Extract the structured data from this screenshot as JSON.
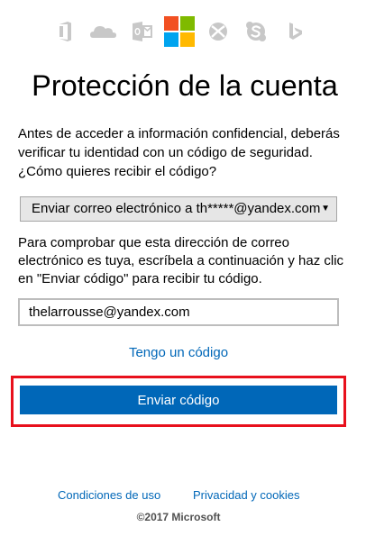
{
  "product_icons": [
    {
      "icon": "office-icon",
      "color": "#c8c8c8"
    },
    {
      "icon": "onedrive-icon",
      "color": "#c8c8c8"
    },
    {
      "icon": "outlook-icon",
      "color": "#c8c8c8"
    },
    {
      "icon": "microsoft-logo-icon",
      "colors": [
        "#f25022",
        "#7fba00",
        "#00a4ef",
        "#ffb900"
      ]
    },
    {
      "icon": "xbox-icon",
      "color": "#c8c8c8"
    },
    {
      "icon": "skype-icon",
      "color": "#c8c8c8"
    },
    {
      "icon": "bing-icon",
      "color": "#c8c8c8"
    }
  ],
  "title": "Protección de la cuenta",
  "intro_text": "Antes de acceder a información confidencial, deberás verificar tu identidad con un código de seguridad. ¿Cómo quieres recibir el código?",
  "method_select": {
    "selected_value": "Enviar correo electrónico a th*****@yandex.com",
    "arrow": "▼"
  },
  "verify_text": "Para comprobar que esta dirección de correo electrónico es tuya, escríbela a continuación y haz clic en \"Enviar código\" para recibir tu código.",
  "email_field": {
    "value": "thelarrousse@yandex.com"
  },
  "have_code_link": "Tengo un código",
  "send_button_label": "Enviar código",
  "footer": {
    "terms_link": "Condiciones de uso",
    "privacy_link": "Privacidad y cookies",
    "copyright": "©2017 Microsoft"
  },
  "colors": {
    "accent": "#0067b8",
    "highlight": "#e8101c",
    "icon_gray": "#c8c8c8"
  }
}
